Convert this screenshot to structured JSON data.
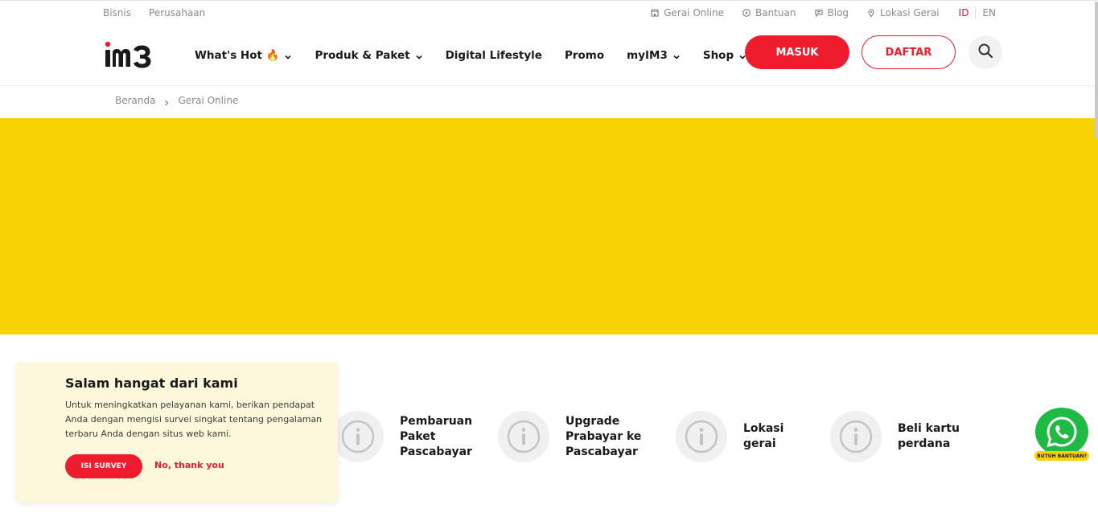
{
  "topbar": {
    "left_links": [
      "Bisnis",
      "Perusahaan"
    ],
    "right_links": [
      {
        "label": "Gerai Online",
        "icon": "store-icon"
      },
      {
        "label": "Bantuan",
        "icon": "help-icon"
      },
      {
        "label": "Blog",
        "icon": "chat-icon"
      },
      {
        "label": "Lokasi Gerai",
        "icon": "location-pin-icon"
      }
    ],
    "languages": {
      "active": "ID",
      "other": "EN"
    }
  },
  "nav": {
    "logo_text": "im3",
    "items": [
      {
        "label": "What's Hot 🔥",
        "has_dropdown": true
      },
      {
        "label": "Produk & Paket",
        "has_dropdown": true
      },
      {
        "label": "Digital Lifestyle",
        "has_dropdown": false
      },
      {
        "label": "Promo",
        "has_dropdown": false
      },
      {
        "label": "myIM3",
        "has_dropdown": true
      },
      {
        "label": "Shop",
        "has_dropdown": true
      }
    ],
    "login_label": "MASUK",
    "register_label": "DAFTAR"
  },
  "breadcrumb": {
    "home": "Beranda",
    "current": "Gerai Online"
  },
  "banner": {
    "color": "#F9D204"
  },
  "features": [
    {
      "label": "Pembaruan Paket Pascabayar"
    },
    {
      "label": "Upgrade Prabayar ke Pascabayar"
    },
    {
      "label": "Lokasi gerai"
    },
    {
      "label": "Beli kartu perdana"
    }
  ],
  "survey": {
    "title": "Salam hangat dari kami",
    "body": "Untuk meningkatkan pelayanan kami, berikan pendapat Anda dengan mengisi survei singkat tentang pengalaman terbaru Anda dengan situs web kami.",
    "accept_label": "ISI SURVEY",
    "decline_label": "No, thank you"
  },
  "whatsapp": {
    "label": "BUTUH BANTUAN?"
  },
  "colors": {
    "brand_red": "#EF1C2D",
    "brand_yellow": "#F9D204",
    "whatsapp_green": "#1FBA44"
  }
}
